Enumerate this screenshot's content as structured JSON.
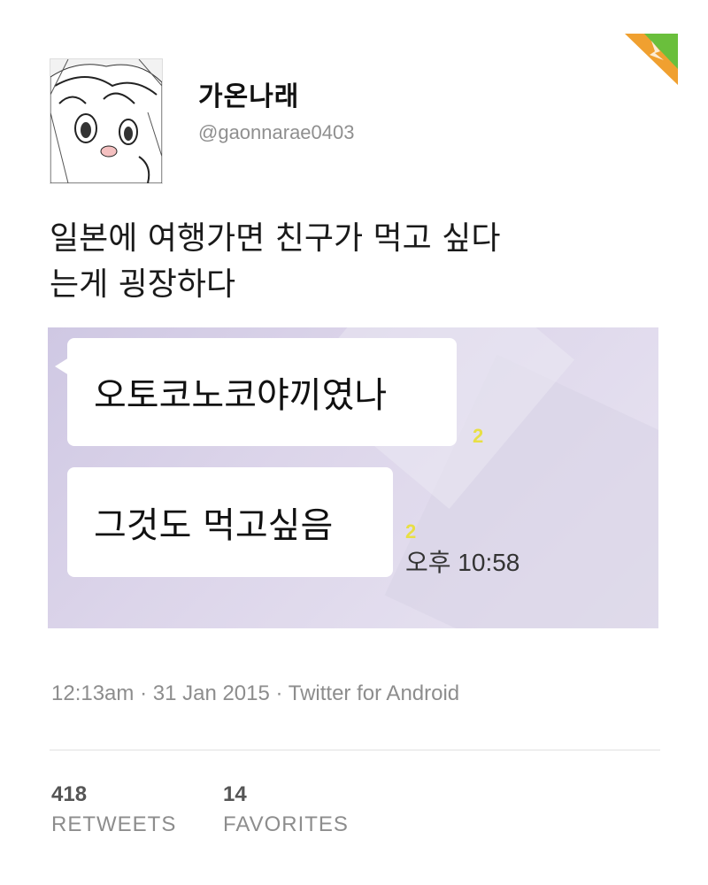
{
  "user": {
    "display_name": "가온나래",
    "handle": "@gaonnarae0403"
  },
  "tweet": {
    "text_line1": "일본에 여행가면 친구가 먹고 싶다",
    "text_line2": "는게 굉장하다"
  },
  "media": {
    "bubble1": "오토코노코야끼였나",
    "bubble2": "그것도 먹고싶음",
    "unread1": "2",
    "unread2": "2",
    "time": "오후 10:58"
  },
  "meta": {
    "timestamp": "12:13am · 31 Jan 2015 · Twitter for Android"
  },
  "stats": {
    "retweets_count": "418",
    "retweets_label": "RETWEETS",
    "favorites_count": "14",
    "favorites_label": "FAVORITES"
  },
  "colors": {
    "unread_badge": "#e8df45",
    "corner_orange": "#f0a030",
    "corner_green": "#6abf3c"
  }
}
